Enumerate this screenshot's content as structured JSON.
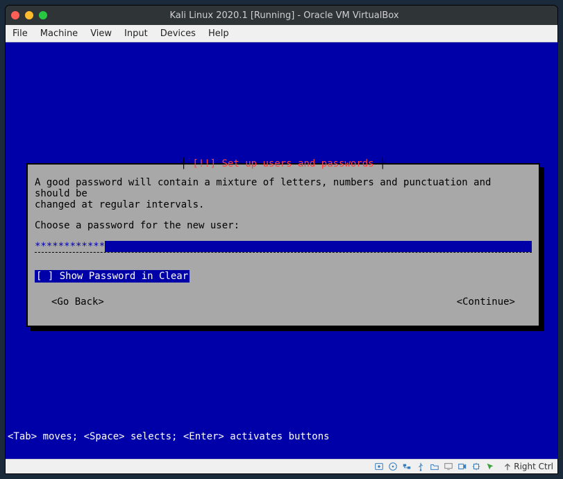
{
  "window": {
    "title": "Kali Linux 2020.1 [Running] - Oracle VM VirtualBox"
  },
  "menubar": {
    "items": [
      "File",
      "Machine",
      "View",
      "Input",
      "Devices",
      "Help"
    ]
  },
  "installer": {
    "dialog_title": "[!!] Set up users and passwords",
    "help_line1": "A good password will contain a mixture of letters, numbers and punctuation and should be",
    "help_line2": "changed at regular intervals.",
    "prompt": "Choose a password for the new user:",
    "password_value": "************",
    "show_password_label": "[ ] Show Password in Clear",
    "go_back": "<Go Back>",
    "continue": "<Continue>",
    "footer_hint": "<Tab> moves; <Space> selects; <Enter> activates buttons"
  },
  "statusbar": {
    "hostkey_label": "Right Ctrl",
    "icons": [
      "disk-icon",
      "cd-icon",
      "audio-icon",
      "network-icon",
      "usb-icon",
      "shared-folder-icon",
      "display-icon",
      "recording-icon",
      "cpu-icon",
      "mouse-integration-icon"
    ]
  },
  "colors": {
    "installer_bg": "#0000a8",
    "dialog_bg": "#a8a8a8",
    "title_red": "#ff4040"
  }
}
